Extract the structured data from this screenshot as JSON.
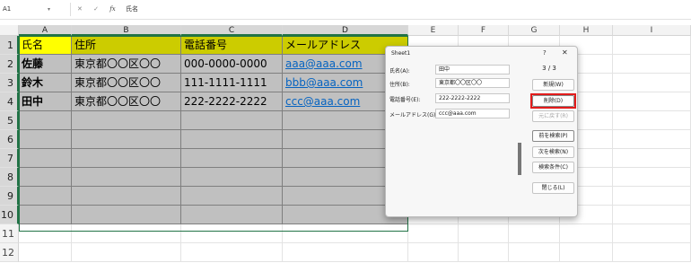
{
  "formula_bar": {
    "name_box": "A1",
    "name_box_arrow": "▾",
    "cancel_icon": "✕",
    "enter_icon": "✓",
    "fx_label": "fx",
    "content": "氏名"
  },
  "sheet": {
    "columns": [
      "A",
      "B",
      "C",
      "D",
      "E",
      "F",
      "G",
      "H",
      "I"
    ],
    "rows": [
      "1",
      "2",
      "3",
      "4",
      "5",
      "6",
      "7",
      "8",
      "9",
      "10",
      "11",
      "12"
    ],
    "table": [
      [
        "氏名",
        "住所",
        "電話番号",
        "メールアドレス"
      ],
      [
        "佐藤",
        "東京都〇〇区〇〇",
        "000-0000-0000",
        "aaa@aaa.com"
      ],
      [
        "鈴木",
        "東京都〇〇区〇〇",
        "111-1111-1111",
        "bbb@aaa.com"
      ],
      [
        "田中",
        "東京都〇〇区〇〇",
        "222-2222-2222",
        "ccc@aaa.com"
      ]
    ],
    "colors": {
      "header_fill": "#cccc00",
      "header_active_fill": "#ffff00",
      "range_fill": "#c0c0c0",
      "link": "#0563c1",
      "selection": "#217346"
    }
  },
  "dialog": {
    "title": "Sheet1",
    "help": "?",
    "close_icon": "✕",
    "record_counter": "3 / 3",
    "fields": [
      {
        "label": "氏名(A):",
        "value": "田中"
      },
      {
        "label": "住所(B):",
        "value": "東京都〇〇区〇〇"
      },
      {
        "label": "電話番号(E):",
        "value": "222-2222-2222"
      },
      {
        "label": "メールアドレス(G):",
        "value": "ccc@aaa.com"
      }
    ],
    "buttons": {
      "new": "新規(W)",
      "delete": "削除(D)",
      "restore": "元に戻す(R)",
      "find_prev": "前を検索(P)",
      "find_next": "次を検索(N)",
      "criteria": "検索条件(C)",
      "close": "閉じる(L)"
    },
    "highlight_color": "#e21b1b"
  }
}
